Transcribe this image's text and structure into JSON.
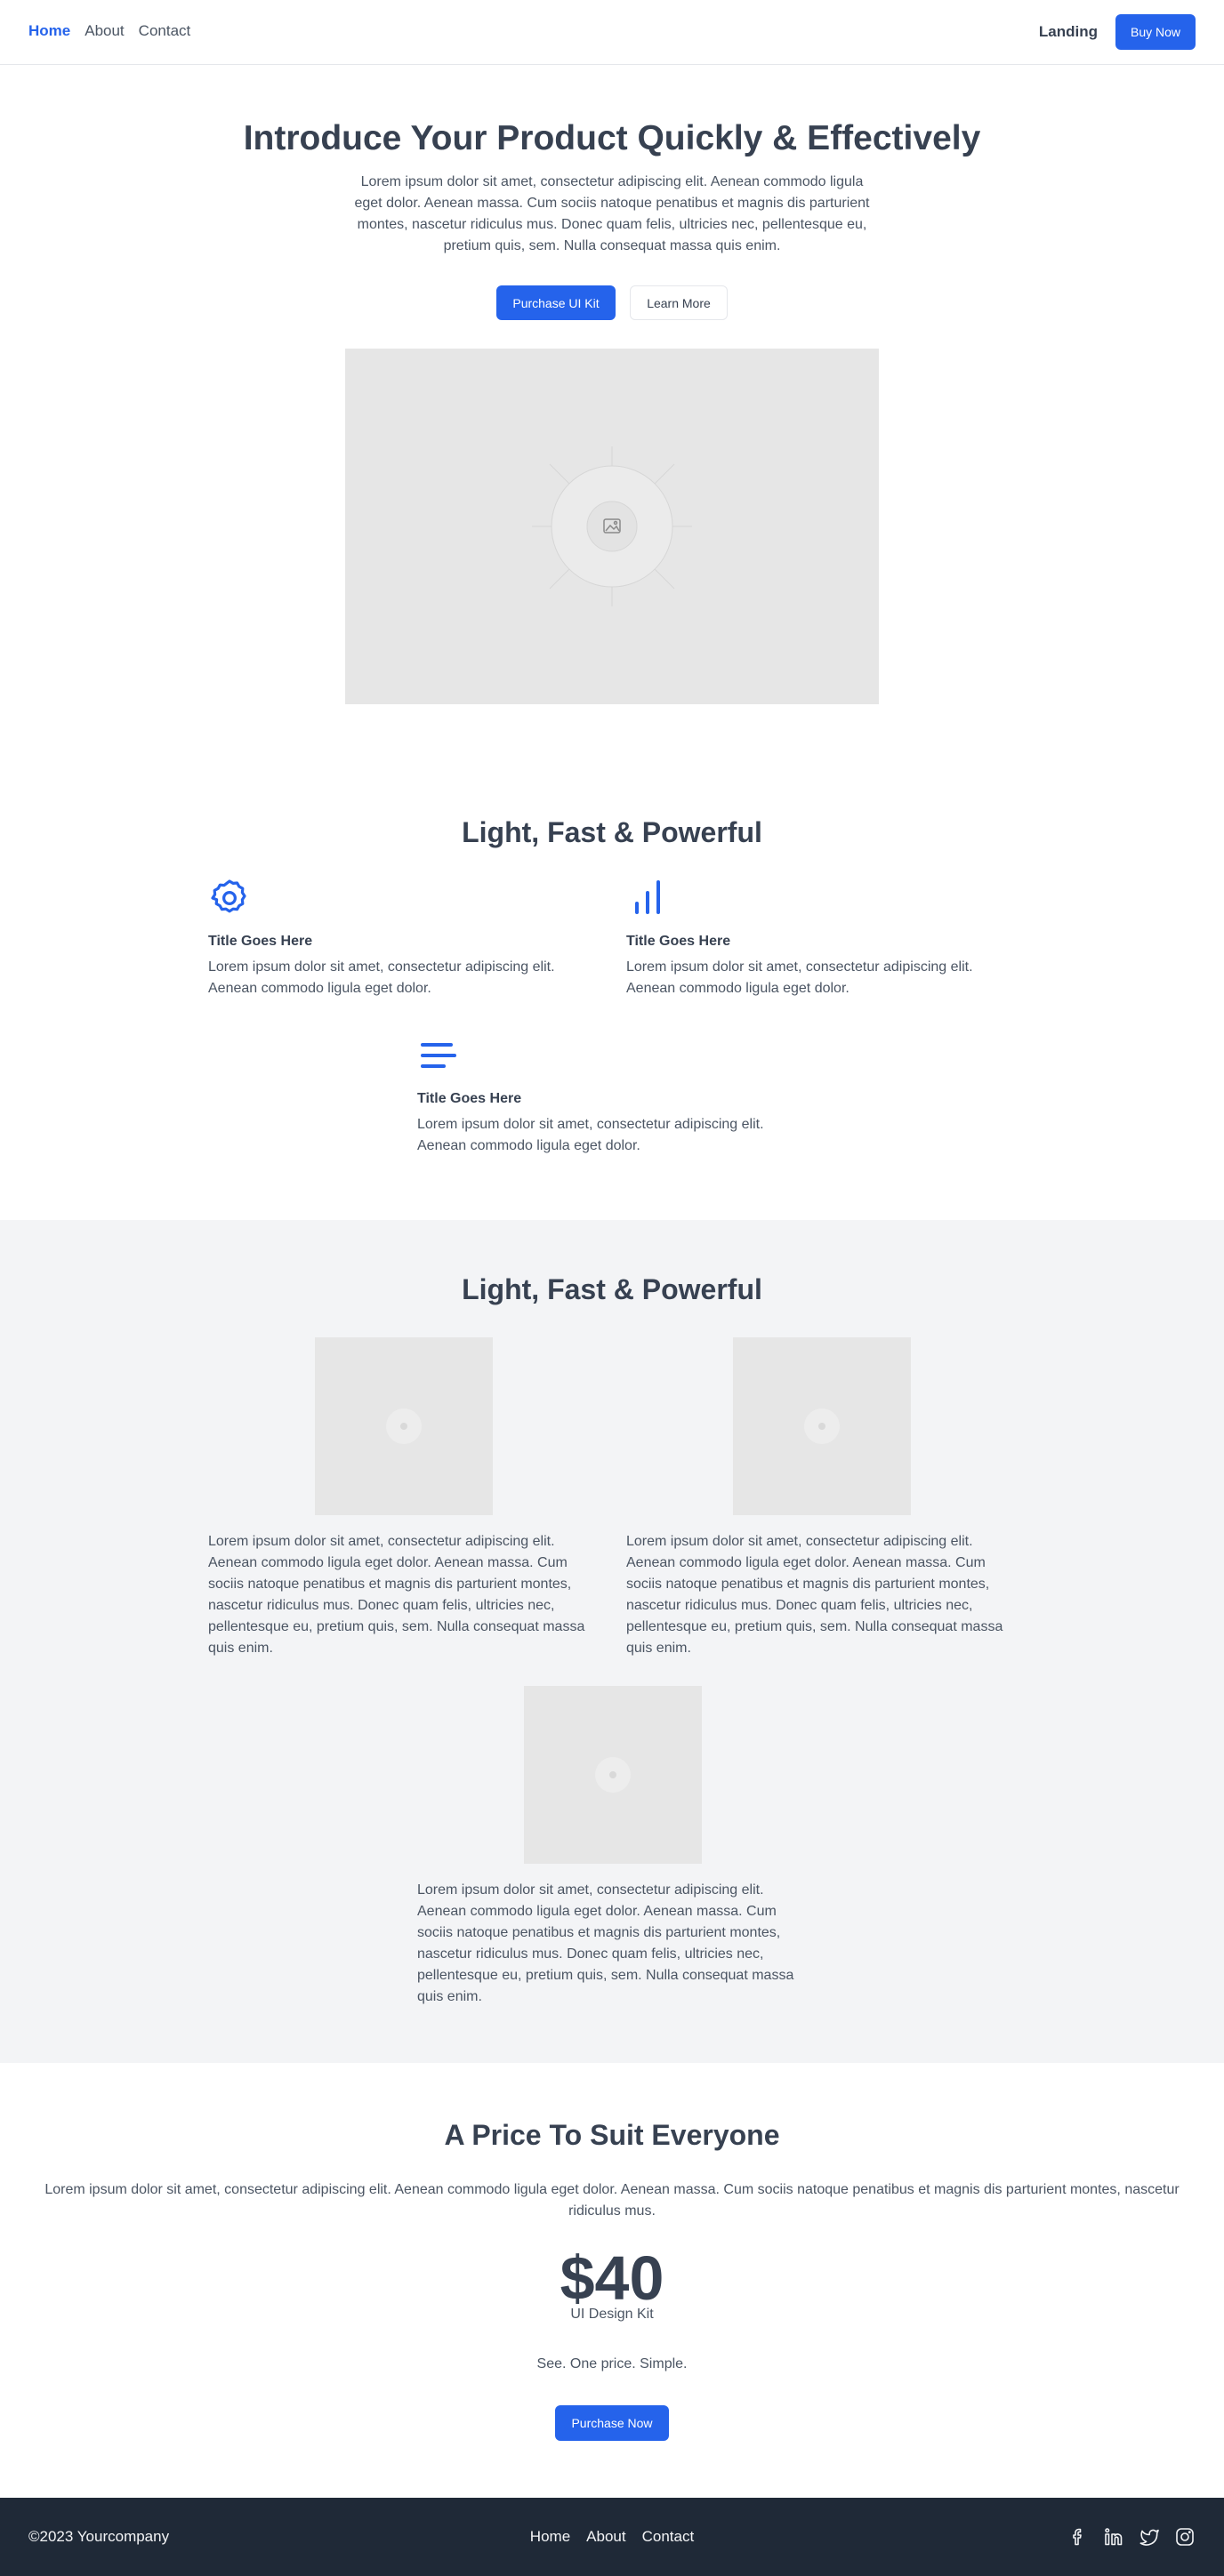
{
  "header": {
    "nav": [
      {
        "label": "Home",
        "active": true
      },
      {
        "label": "About",
        "active": false
      },
      {
        "label": "Contact",
        "active": false
      }
    ],
    "landing_label": "Landing",
    "buy_label": "Buy Now"
  },
  "hero": {
    "title": "Introduce Your Product Quickly & Effectively",
    "text": "Lorem ipsum dolor sit amet, consectetur adipiscing elit. Aenean commodo ligula eget dolor. Aenean massa. Cum sociis natoque penatibus et magnis dis parturient montes, nascetur ridiculus mus. Donec quam felis, ultricies nec, pellentesque eu, pretium quis, sem. Nulla consequat massa quis enim.",
    "primary_button": "Purchase UI Kit",
    "secondary_button": "Learn More",
    "image_icon": "image-placeholder-icon"
  },
  "features": {
    "title": "Light, Fast & Powerful",
    "items": [
      {
        "icon": "gear-icon",
        "title": "Title Goes Here",
        "text": "Lorem ipsum dolor sit amet, consectetur adipiscing elit. Aenean commodo ligula eget dolor."
      },
      {
        "icon": "bar-chart-icon",
        "title": "Title Goes Here",
        "text": "Lorem ipsum dolor sit amet, consectetur adipiscing elit. Aenean commodo ligula eget dolor."
      },
      {
        "icon": "menu-lines-icon",
        "title": "Title Goes Here",
        "text": "Lorem ipsum dolor sit amet, consectetur adipiscing elit. Aenean commodo ligula eget dolor."
      }
    ]
  },
  "showcase": {
    "title": "Light, Fast & Powerful",
    "cards": [
      {
        "text": "Lorem ipsum dolor sit amet, consectetur adipiscing elit. Aenean commodo ligula eget dolor. Aenean massa. Cum sociis natoque penatibus et magnis dis parturient montes, nascetur ridiculus mus. Donec quam felis, ultricies nec, pellentesque eu, pretium quis, sem. Nulla consequat massa quis enim."
      },
      {
        "text": "Lorem ipsum dolor sit amet, consectetur adipiscing elit. Aenean commodo ligula eget dolor. Aenean massa. Cum sociis natoque penatibus et magnis dis parturient montes, nascetur ridiculus mus. Donec quam felis, ultricies nec, pellentesque eu, pretium quis, sem. Nulla consequat massa quis enim."
      },
      {
        "text": "Lorem ipsum dolor sit amet, consectetur adipiscing elit. Aenean commodo ligula eget dolor. Aenean massa. Cum sociis natoque penatibus et magnis dis parturient montes, nascetur ridiculus mus. Donec quam felis, ultricies nec, pellentesque eu, pretium quis, sem. Nulla consequat massa quis enim."
      }
    ]
  },
  "pricing": {
    "title": "A Price To Suit Everyone",
    "text": "Lorem ipsum dolor sit amet, consectetur adipiscing elit. Aenean commodo ligula eget dolor. Aenean massa. Cum sociis natoque penatibus et magnis dis parturient montes, nascetur ridiculus mus.",
    "price": "$40",
    "product": "UI Design Kit",
    "note": "See. One price. Simple.",
    "button": "Purchase Now"
  },
  "footer": {
    "copyright": "©2023 Yourcompany",
    "nav": [
      "Home",
      "About",
      "Contact"
    ],
    "social": [
      "facebook-icon",
      "linkedin-icon",
      "twitter-icon",
      "instagram-icon"
    ]
  },
  "colors": {
    "accent": "#2563eb",
    "text": "#374151",
    "footer_bg": "#1f2937",
    "section_bg": "#f3f4f6",
    "placeholder": "#e6e6e6"
  }
}
